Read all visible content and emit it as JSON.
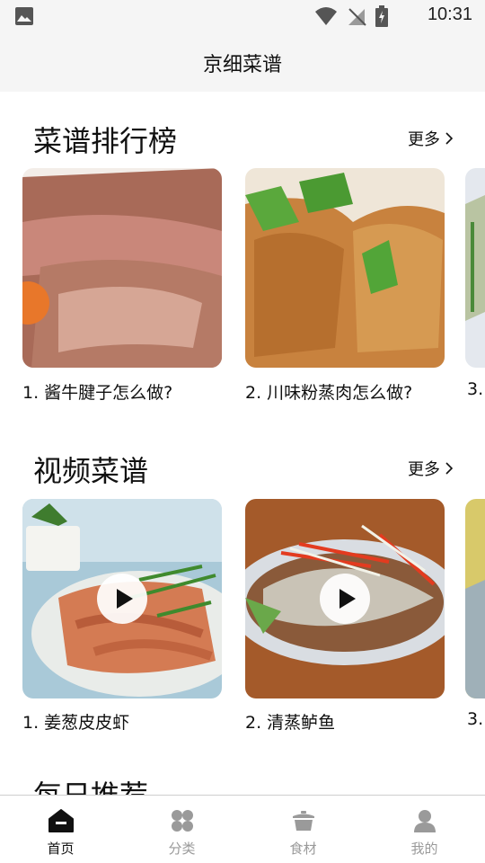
{
  "status": {
    "time": "10:31"
  },
  "app": {
    "title": "京细菜谱"
  },
  "ranking": {
    "title": "菜谱排行榜",
    "more": "更多",
    "items": [
      {
        "caption": "1. 酱牛腱子怎么做?"
      },
      {
        "caption": "2. 川味粉蒸肉怎么做?"
      },
      {
        "caption": "3."
      }
    ]
  },
  "video": {
    "title": "视频菜谱",
    "more": "更多",
    "items": [
      {
        "caption": "1. 姜葱皮皮虾"
      },
      {
        "caption": "2. 清蒸鲈鱼"
      },
      {
        "caption": "3."
      }
    ]
  },
  "daily": {
    "title": "每日推荐"
  },
  "nav": {
    "items": [
      {
        "label": "首页",
        "icon": "home-icon"
      },
      {
        "label": "分类",
        "icon": "category-icon"
      },
      {
        "label": "食材",
        "icon": "pot-icon"
      },
      {
        "label": "我的",
        "icon": "user-icon"
      }
    ]
  },
  "colors": {
    "active": "#111111",
    "inactive": "#9a9a9a",
    "bar": "#f5f5f5"
  }
}
